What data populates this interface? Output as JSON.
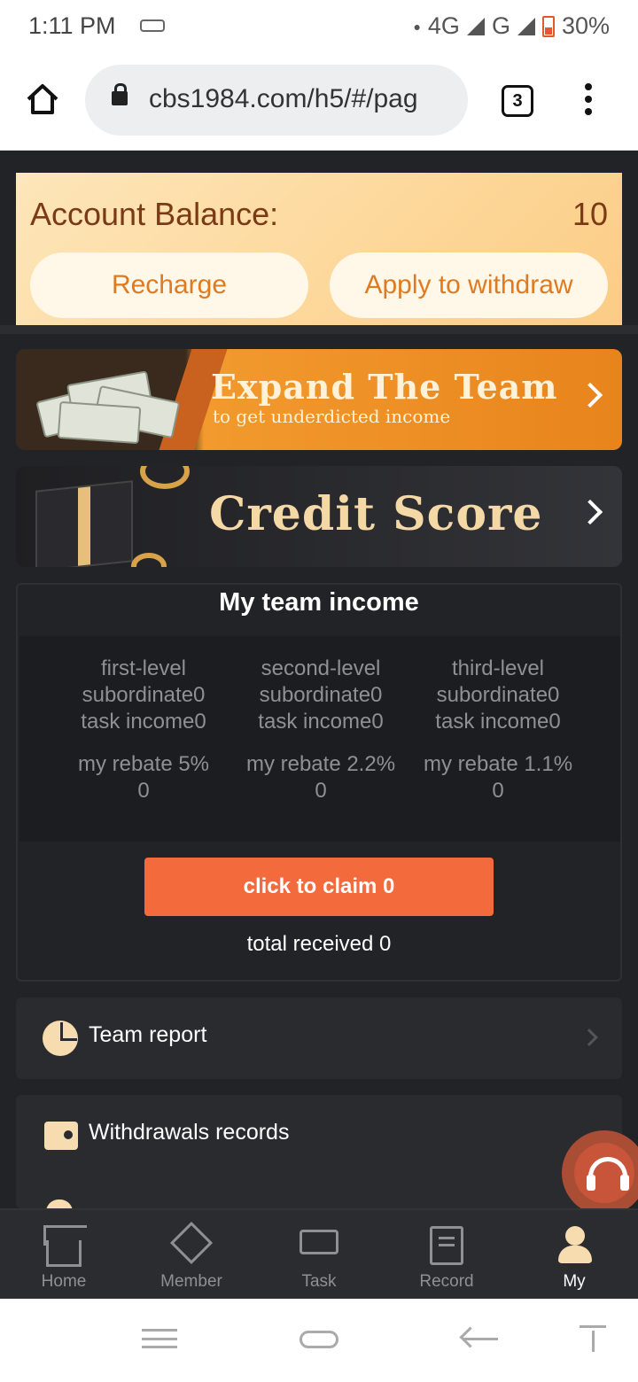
{
  "status_bar": {
    "time": "1:11 PM",
    "network": "4G",
    "network2": "G",
    "battery": "30%"
  },
  "browser": {
    "url": "cbs1984.com/h5/#/pag",
    "tab_count": "3"
  },
  "balance": {
    "label": "Account Balance:",
    "value": "10",
    "recharge_label": "Recharge",
    "withdraw_label": "Apply to withdraw"
  },
  "banners": {
    "team_title": "Expand The Team",
    "team_subtitle": "to get underdicted income",
    "credit_title": "Credit Score"
  },
  "team_income": {
    "heading": "My team income",
    "levels": [
      {
        "line1": "first-level",
        "line2": "subordinate0",
        "line3": "task income0",
        "rebate": "my rebate 5%",
        "rebate_value": "0"
      },
      {
        "line1": "second-level",
        "line2": "subordinate0",
        "line3": "task income0",
        "rebate": "my rebate 2.2%",
        "rebate_value": "0"
      },
      {
        "line1": "third-level",
        "line2": "subordinate0",
        "line3": "task income0",
        "rebate": "my rebate 1.1%",
        "rebate_value": "0"
      }
    ],
    "claim_label": "click to claim 0",
    "total_received": "total received 0"
  },
  "menu_rows": {
    "team_report": "Team report",
    "withdrawals_records": "Withdrawals records"
  },
  "tab_bar": [
    {
      "label": "Home",
      "icon": "home-icon"
    },
    {
      "label": "Member",
      "icon": "member-icon"
    },
    {
      "label": "Task",
      "icon": "task-icon"
    },
    {
      "label": "Record",
      "icon": "record-icon"
    },
    {
      "label": "My",
      "icon": "user-icon",
      "active": true
    }
  ],
  "colors": {
    "accent_orange": "#f36a3d",
    "balance_text": "#7a3a16",
    "background": "#222326"
  }
}
